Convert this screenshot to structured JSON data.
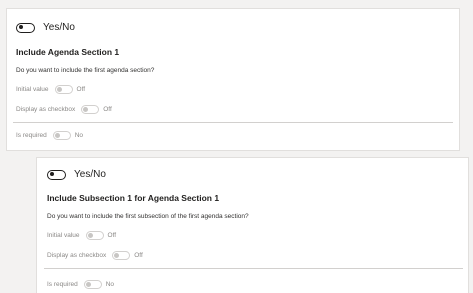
{
  "fields": [
    {
      "type_label": "Yes/No",
      "title": "Include Agenda Section 1",
      "description": "Do you want to include the first agenda section?",
      "initial_value_label": "Initial value",
      "initial_value": "Off",
      "display_checkbox_label": "Display as checkbox",
      "display_checkbox_value": "Off",
      "required_label": "Is required",
      "required_value": "No"
    },
    {
      "type_label": "Yes/No",
      "title": "Include Subsection 1 for Agenda Section 1",
      "description": "Do you want to include the first subsection of the first agenda section?",
      "initial_value_label": "Initial value",
      "initial_value": "Off",
      "display_checkbox_label": "Display as checkbox",
      "display_checkbox_value": "Off",
      "required_label": "Is required",
      "required_value": "No"
    }
  ]
}
